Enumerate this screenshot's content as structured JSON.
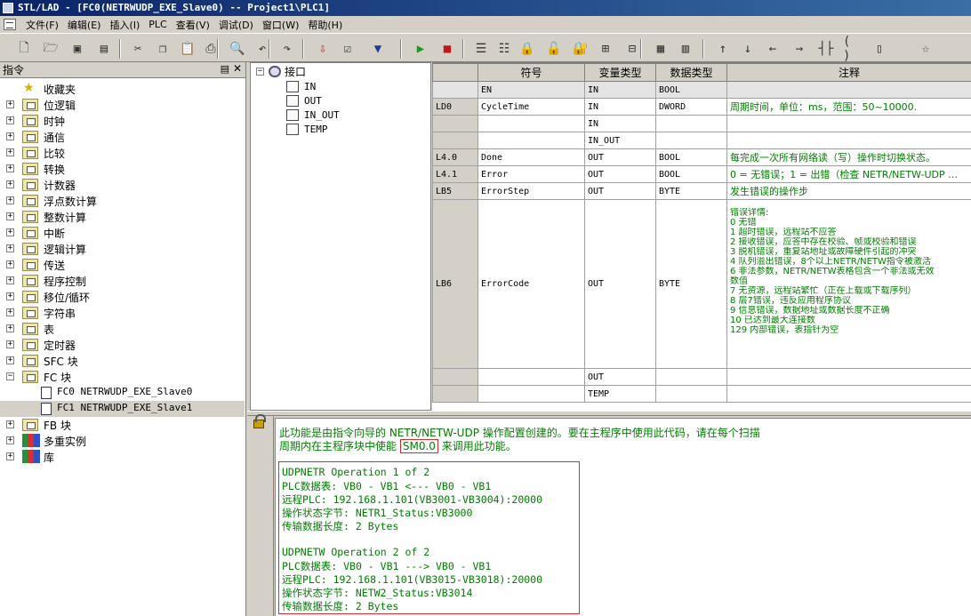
{
  "window": {
    "title": "STL/LAD - [FC0(NETRWUDP_EXE_Slave0) -- Project1\\PLC1]"
  },
  "menu": [
    {
      "label": "文件(F)"
    },
    {
      "label": "编辑(E)"
    },
    {
      "label": "插入(I)"
    },
    {
      "label": "PLC"
    },
    {
      "label": "查看(V)"
    },
    {
      "label": "调试(D)"
    },
    {
      "label": "窗口(W)"
    },
    {
      "label": "帮助(H)"
    }
  ],
  "toolbar_icons": [
    "new-file-icon",
    "open-folder-icon",
    "save-icon",
    "save-all-icon",
    "cut-icon",
    "copy-icon",
    "paste-icon",
    "print-icon",
    "print-preview-icon",
    "undo-icon",
    "redo-icon",
    "download-icon",
    "compile-icon",
    "download-arrow-icon",
    "run-icon",
    "stop-icon",
    "monitor-icon",
    "status-table-icon",
    "lock-icon",
    "unlock-icon",
    "protect-icon",
    "insert-network-icon",
    "delete-network-icon",
    "symbol-table-icon",
    "data-block-icon",
    "contact-up-icon",
    "contact-down-icon",
    "wire-left-icon",
    "wire-right-icon",
    "contact-icon",
    "coil-icon",
    "box-icon",
    "star-icon"
  ],
  "instruction_panel": {
    "title": "指令",
    "items": [
      {
        "label": "收藏夹",
        "icon": "star"
      },
      {
        "label": "位逻辑",
        "icon": "folder"
      },
      {
        "label": "时钟",
        "icon": "folder"
      },
      {
        "label": "通信",
        "icon": "folder"
      },
      {
        "label": "比较",
        "icon": "folder"
      },
      {
        "label": "转换",
        "icon": "folder"
      },
      {
        "label": "计数器",
        "icon": "folder"
      },
      {
        "label": "浮点数计算",
        "icon": "folder"
      },
      {
        "label": "整数计算",
        "icon": "folder"
      },
      {
        "label": "中断",
        "icon": "folder"
      },
      {
        "label": "逻辑计算",
        "icon": "folder"
      },
      {
        "label": "传送",
        "icon": "folder"
      },
      {
        "label": "程序控制",
        "icon": "folder"
      },
      {
        "label": "移位/循环",
        "icon": "folder"
      },
      {
        "label": "字符串",
        "icon": "folder"
      },
      {
        "label": "表",
        "icon": "folder"
      },
      {
        "label": "定时器",
        "icon": "folder"
      },
      {
        "label": "SFC 块",
        "icon": "folder"
      },
      {
        "label": "FC 块",
        "icon": "folder",
        "expanded": true
      },
      {
        "label": "FC0  NETRWUDP_EXE_Slave0",
        "icon": "page",
        "child": true
      },
      {
        "label": "FC1  NETRWUDP_EXE_Slave1",
        "icon": "page",
        "child": true,
        "selected": true
      },
      {
        "label": "FB 块",
        "icon": "folder"
      },
      {
        "label": "多重实例",
        "icon": "books"
      },
      {
        "label": "库",
        "icon": "books"
      }
    ]
  },
  "interface_tree": {
    "root": "接口",
    "children": [
      "IN",
      "OUT",
      "IN_OUT",
      "TEMP"
    ]
  },
  "var_table": {
    "headers": [
      "符号",
      "变量类型",
      "数据类型",
      "注释"
    ],
    "rows": [
      {
        "addr": "",
        "symbol": "EN",
        "vartype": "IN",
        "datatype": "BOOL",
        "comment": ""
      },
      {
        "addr": "LD0",
        "symbol": "CycleTime",
        "vartype": "IN",
        "datatype": "DWORD",
        "comment": "周期时间，单位：ms，范围：50~10000."
      },
      {
        "addr": "",
        "symbol": "",
        "vartype": "IN",
        "datatype": "",
        "comment": ""
      },
      {
        "addr": "",
        "symbol": "",
        "vartype": "IN_OUT",
        "datatype": "",
        "comment": ""
      },
      {
        "addr": "L4.0",
        "symbol": "Done",
        "vartype": "OUT",
        "datatype": "BOOL",
        "comment": "每完成一次所有网络读（写）操作时切换状态。"
      },
      {
        "addr": "L4.1",
        "symbol": "Error",
        "vartype": "OUT",
        "datatype": "BOOL",
        "comment": "0 = 无错误；1 = 出错（检查 NETR/NETW-UDP …"
      },
      {
        "addr": "LB5",
        "symbol": "ErrorStep",
        "vartype": "OUT",
        "datatype": "BYTE",
        "comment": "发生错误的操作步"
      },
      {
        "addr": "LB6",
        "symbol": "ErrorCode",
        "vartype": "OUT",
        "datatype": "BYTE",
        "comment_lines": [
          "错误详情:",
          "0 无错",
          "1 超时错误，远程站不应答",
          "2 接收错误，应答中存在校验、帧或校验和错误",
          "3 脱机错误，重复站地址或故障硬件引起的冲突",
          "4 队列溢出错误，8个以上NETR/NETW指令被激活",
          "6 非法参数，NETR/NETW表格包含一个非法或无效",
          "数值",
          "7 无资源，远程站繁忙（正在上载或下载序列）",
          "8 层7错误，违反应用程序协议",
          "9 信息错误，数据地址或数据长度不正确",
          "10 已达到最大连接数",
          "129 内部错误，表指针为空"
        ]
      },
      {
        "addr": "",
        "symbol": "",
        "vartype": "OUT",
        "datatype": "",
        "comment": ""
      },
      {
        "addr": "",
        "symbol": "",
        "vartype": "TEMP",
        "datatype": "",
        "comment": ""
      }
    ]
  },
  "editor": {
    "comment_line1": "此功能是由指令向导的 NETR/NETW-UDP 操作配置创建的。要在主程序中使用此代码，请在每个扫描",
    "comment_line2_a": "周期内在主程序块中使能",
    "comment_line2_sm": "SM0.0",
    "comment_line2_b": "来调用此功能。",
    "code_lines": [
      "UDPNETR     Operation 1 of 2",
      "PLC数据表:   VB0 - VB1 <--- VB0 - VB1",
      "远程PLC:     192.168.1.101(VB3001-VB3004):20000",
      "操作状态字节: NETR1_Status:VB3000",
      "传输数据长度: 2 Bytes",
      "",
      "UDPNETW     Operation 2 of 2",
      "PLC数据表:   VB0 - VB1 ---> VB0 - VB1",
      "远程PLC:     192.168.1.101(VB3015-VB3018):20000",
      "操作状态字节: NETW2_Status:VB3014",
      "传输数据长度: 2 Bytes"
    ]
  }
}
